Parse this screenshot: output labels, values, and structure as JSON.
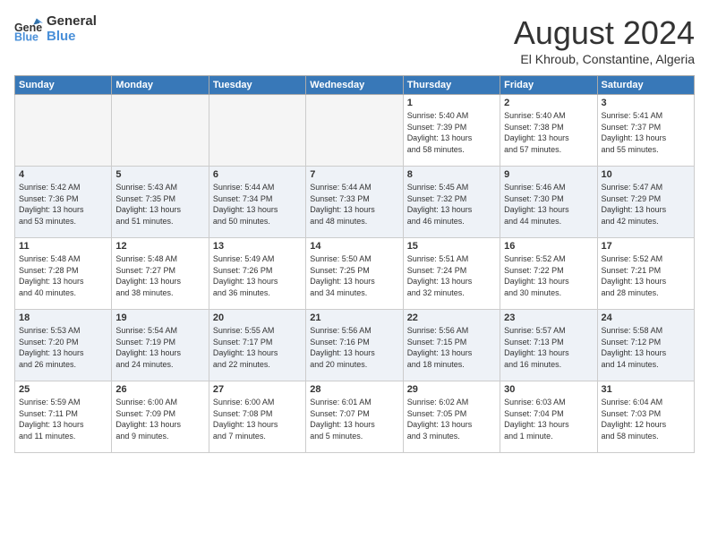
{
  "header": {
    "logo_line1": "General",
    "logo_line2": "Blue",
    "month_year": "August 2024",
    "location": "El Khroub, Constantine, Algeria"
  },
  "weekdays": [
    "Sunday",
    "Monday",
    "Tuesday",
    "Wednesday",
    "Thursday",
    "Friday",
    "Saturday"
  ],
  "weeks": [
    [
      {
        "day": "",
        "info": ""
      },
      {
        "day": "",
        "info": ""
      },
      {
        "day": "",
        "info": ""
      },
      {
        "day": "",
        "info": ""
      },
      {
        "day": "1",
        "info": "Sunrise: 5:40 AM\nSunset: 7:39 PM\nDaylight: 13 hours\nand 58 minutes."
      },
      {
        "day": "2",
        "info": "Sunrise: 5:40 AM\nSunset: 7:38 PM\nDaylight: 13 hours\nand 57 minutes."
      },
      {
        "day": "3",
        "info": "Sunrise: 5:41 AM\nSunset: 7:37 PM\nDaylight: 13 hours\nand 55 minutes."
      }
    ],
    [
      {
        "day": "4",
        "info": "Sunrise: 5:42 AM\nSunset: 7:36 PM\nDaylight: 13 hours\nand 53 minutes."
      },
      {
        "day": "5",
        "info": "Sunrise: 5:43 AM\nSunset: 7:35 PM\nDaylight: 13 hours\nand 51 minutes."
      },
      {
        "day": "6",
        "info": "Sunrise: 5:44 AM\nSunset: 7:34 PM\nDaylight: 13 hours\nand 50 minutes."
      },
      {
        "day": "7",
        "info": "Sunrise: 5:44 AM\nSunset: 7:33 PM\nDaylight: 13 hours\nand 48 minutes."
      },
      {
        "day": "8",
        "info": "Sunrise: 5:45 AM\nSunset: 7:32 PM\nDaylight: 13 hours\nand 46 minutes."
      },
      {
        "day": "9",
        "info": "Sunrise: 5:46 AM\nSunset: 7:30 PM\nDaylight: 13 hours\nand 44 minutes."
      },
      {
        "day": "10",
        "info": "Sunrise: 5:47 AM\nSunset: 7:29 PM\nDaylight: 13 hours\nand 42 minutes."
      }
    ],
    [
      {
        "day": "11",
        "info": "Sunrise: 5:48 AM\nSunset: 7:28 PM\nDaylight: 13 hours\nand 40 minutes."
      },
      {
        "day": "12",
        "info": "Sunrise: 5:48 AM\nSunset: 7:27 PM\nDaylight: 13 hours\nand 38 minutes."
      },
      {
        "day": "13",
        "info": "Sunrise: 5:49 AM\nSunset: 7:26 PM\nDaylight: 13 hours\nand 36 minutes."
      },
      {
        "day": "14",
        "info": "Sunrise: 5:50 AM\nSunset: 7:25 PM\nDaylight: 13 hours\nand 34 minutes."
      },
      {
        "day": "15",
        "info": "Sunrise: 5:51 AM\nSunset: 7:24 PM\nDaylight: 13 hours\nand 32 minutes."
      },
      {
        "day": "16",
        "info": "Sunrise: 5:52 AM\nSunset: 7:22 PM\nDaylight: 13 hours\nand 30 minutes."
      },
      {
        "day": "17",
        "info": "Sunrise: 5:52 AM\nSunset: 7:21 PM\nDaylight: 13 hours\nand 28 minutes."
      }
    ],
    [
      {
        "day": "18",
        "info": "Sunrise: 5:53 AM\nSunset: 7:20 PM\nDaylight: 13 hours\nand 26 minutes."
      },
      {
        "day": "19",
        "info": "Sunrise: 5:54 AM\nSunset: 7:19 PM\nDaylight: 13 hours\nand 24 minutes."
      },
      {
        "day": "20",
        "info": "Sunrise: 5:55 AM\nSunset: 7:17 PM\nDaylight: 13 hours\nand 22 minutes."
      },
      {
        "day": "21",
        "info": "Sunrise: 5:56 AM\nSunset: 7:16 PM\nDaylight: 13 hours\nand 20 minutes."
      },
      {
        "day": "22",
        "info": "Sunrise: 5:56 AM\nSunset: 7:15 PM\nDaylight: 13 hours\nand 18 minutes."
      },
      {
        "day": "23",
        "info": "Sunrise: 5:57 AM\nSunset: 7:13 PM\nDaylight: 13 hours\nand 16 minutes."
      },
      {
        "day": "24",
        "info": "Sunrise: 5:58 AM\nSunset: 7:12 PM\nDaylight: 13 hours\nand 14 minutes."
      }
    ],
    [
      {
        "day": "25",
        "info": "Sunrise: 5:59 AM\nSunset: 7:11 PM\nDaylight: 13 hours\nand 11 minutes."
      },
      {
        "day": "26",
        "info": "Sunrise: 6:00 AM\nSunset: 7:09 PM\nDaylight: 13 hours\nand 9 minutes."
      },
      {
        "day": "27",
        "info": "Sunrise: 6:00 AM\nSunset: 7:08 PM\nDaylight: 13 hours\nand 7 minutes."
      },
      {
        "day": "28",
        "info": "Sunrise: 6:01 AM\nSunset: 7:07 PM\nDaylight: 13 hours\nand 5 minutes."
      },
      {
        "day": "29",
        "info": "Sunrise: 6:02 AM\nSunset: 7:05 PM\nDaylight: 13 hours\nand 3 minutes."
      },
      {
        "day": "30",
        "info": "Sunrise: 6:03 AM\nSunset: 7:04 PM\nDaylight: 13 hours\nand 1 minute."
      },
      {
        "day": "31",
        "info": "Sunrise: 6:04 AM\nSunset: 7:03 PM\nDaylight: 12 hours\nand 58 minutes."
      }
    ]
  ]
}
